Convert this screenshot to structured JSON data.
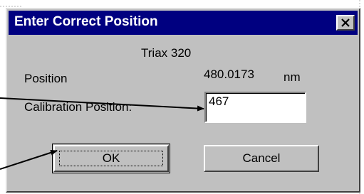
{
  "dialog": {
    "title": "Enter Correct Position",
    "close_label": "×",
    "device_name": "Triax 320",
    "position_label": "Position",
    "position_value": "480.0173",
    "position_unit": "nm",
    "calibration_label": "Calibration Position:",
    "calibration_value": "467",
    "ok_label": "OK",
    "cancel_label": "Cancel"
  },
  "colors": {
    "titlebar": "#000080",
    "dialog_bg": "#c0c0c0"
  }
}
